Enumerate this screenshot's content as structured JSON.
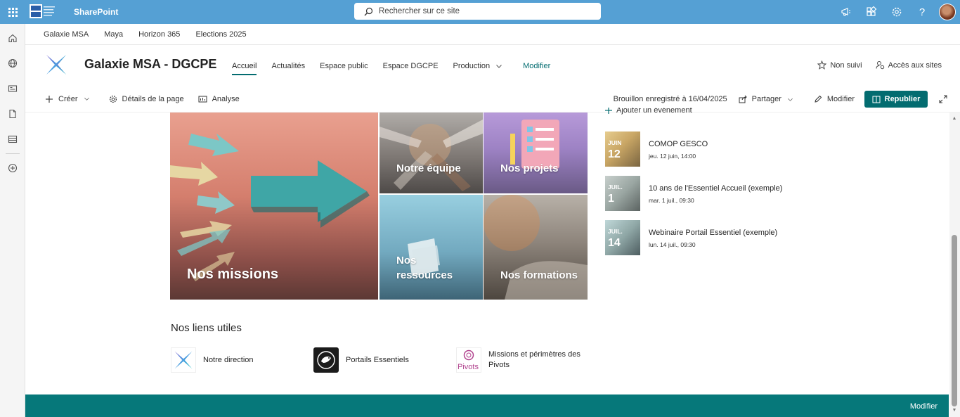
{
  "suite_bar": {
    "app_name": "SharePoint",
    "search_placeholder": "Rechercher sur ce site",
    "accent": "#55a0d4"
  },
  "left_rail": {
    "icons": [
      "home-icon",
      "globe-icon",
      "news-icon",
      "document-icon",
      "list-icon",
      "add-circle-icon"
    ]
  },
  "hub_nav": [
    "Galaxie MSA",
    "Maya",
    "Horizon 365",
    "Elections 2025"
  ],
  "site": {
    "title": "Galaxie MSA - DGCPE",
    "nav": [
      "Accueil",
      "Actualités",
      "Espace public",
      "Espace DGCPE",
      "Production"
    ],
    "nav_edit": "Modifier",
    "follow": "Non suivi",
    "site_access": "Accès aux sites"
  },
  "command_bar": {
    "create": "Créer",
    "page_details": "Détails de la page",
    "analytics": "Analyse",
    "draft_status": "Brouillon enregistré à 16/04/2025",
    "share": "Partager",
    "edit": "Modifier",
    "republish": "Republier",
    "brand_color": "#036c70"
  },
  "hero": {
    "main": "Nos missions",
    "tiles": [
      "Notre équipe",
      "Nos projets",
      "Nos ressources",
      "Nos formations"
    ]
  },
  "events": {
    "add_label": "Ajouter un événement",
    "items": [
      {
        "month": "JUIN",
        "day": "12",
        "title": "COMOP GESCO",
        "date": "jeu. 12 juin, 14:00"
      },
      {
        "month": "JUIL.",
        "day": "1",
        "title": "10 ans de l'Essentiel Accueil (exemple)",
        "date": "mar. 1 juil., 09:30"
      },
      {
        "month": "JUIL.",
        "day": "14",
        "title": "Webinaire Portail Essentiel (exemple)",
        "date": "lun. 14 juil., 09:30"
      }
    ]
  },
  "quick_links": {
    "title": "Nos liens utiles",
    "items": [
      {
        "label": "Notre direction"
      },
      {
        "label": "Portails Essentiels"
      },
      {
        "label": "Missions et périmètres des Pivots",
        "icon_text": "Pivots"
      }
    ]
  },
  "footer": {
    "edit": "Modifier",
    "color": "#06787a"
  }
}
